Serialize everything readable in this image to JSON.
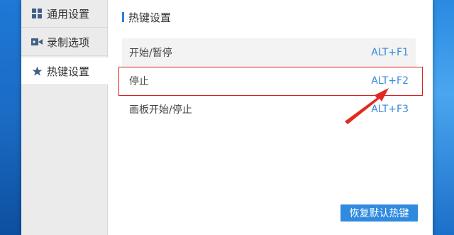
{
  "sidebar": {
    "items": [
      {
        "label": "通用设置",
        "icon": "grid-icon"
      },
      {
        "label": "录制选项",
        "icon": "video-camera-icon"
      },
      {
        "label": "热键设置",
        "icon": "star-icon"
      }
    ],
    "active_index": 2
  },
  "main": {
    "section_title": "热键设置",
    "hotkeys": [
      {
        "name": "开始/暂停",
        "key": "ALT+F1"
      },
      {
        "name": "停止",
        "key": "ALT+F2"
      },
      {
        "name": "画板开始/停止",
        "key": "ALT+F3"
      }
    ],
    "restore_button_label": "恢复默认热键"
  },
  "annotation": {
    "highlight_color": "#d9201e",
    "arrow_color": "#e02a20",
    "highlighted_row": 1
  },
  "colors": {
    "accent": "#2f8ae0",
    "key_text": "#3a8ad6"
  }
}
